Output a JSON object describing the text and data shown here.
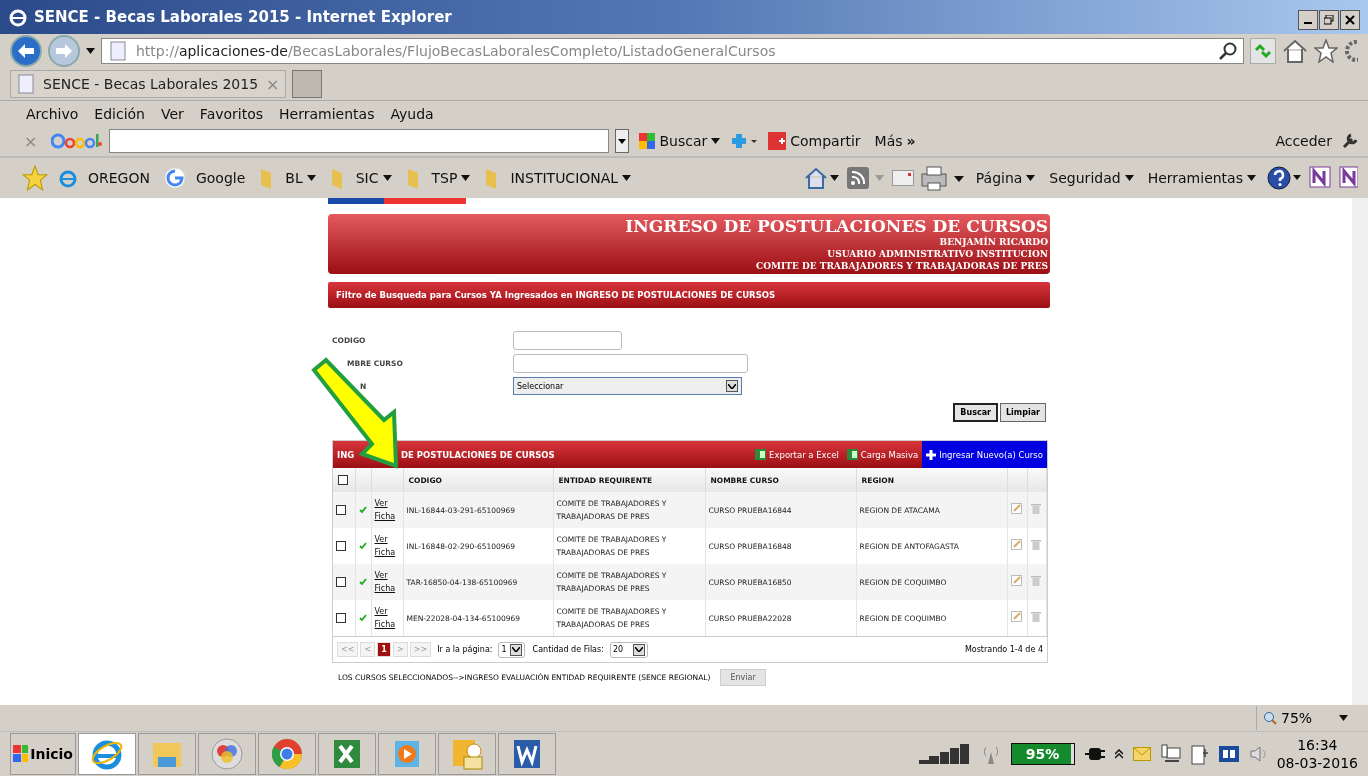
{
  "window": {
    "title": "SENCE - Becas Laborales 2015 - Internet Explorer"
  },
  "address": {
    "scheme": "http://",
    "host": "aplicaciones-de",
    "path": "/BecasLaborales/FlujoBecasLaboralesCompleto/ListadoGeneralCursos"
  },
  "tab": {
    "title": "SENCE - Becas Laborales 2015",
    "close": "×"
  },
  "menu": [
    "Archivo",
    "Edición",
    "Ver",
    "Favoritos",
    "Herramientas",
    "Ayuda"
  ],
  "google_toolbar": {
    "close": "×",
    "search_button": "Buscar",
    "share_button": "Compartir",
    "more": "Más",
    "more_glyph": "»",
    "sign_in": "Acceder"
  },
  "favorites": [
    {
      "kind": "ie",
      "label": "OREGON"
    },
    {
      "kind": "google",
      "label": "Google"
    },
    {
      "kind": "folder",
      "label": "BL"
    },
    {
      "kind": "folder",
      "label": "SIC"
    },
    {
      "kind": "folder",
      "label": "TSP"
    },
    {
      "kind": "folder",
      "label": "INSTITUCIONAL"
    }
  ],
  "command_bar": [
    "Página",
    "Seguridad",
    "Herramientas"
  ],
  "page_header": {
    "title": "INGRESO DE POSTULACIONES DE CURSOS",
    "lines": [
      "BENJAMÍN RICARDO",
      "USUARIO ADMINISTRATIVO INSTITUCION",
      "COMITE DE TRABAJADORES Y TRABAJADORAS DE PRES"
    ]
  },
  "filter": {
    "title": "Filtro de Busqueda para Cursos YA Ingresados en INGRESO DE POSTULACIONES DE CURSOS",
    "fields": [
      {
        "kind": "short",
        "label": "CODIGO"
      },
      {
        "kind": "long",
        "label": "MBRE CURSO"
      },
      {
        "kind": "select",
        "label": "N",
        "value": "Seleccionar"
      }
    ],
    "buttons": [
      "Buscar",
      "Limpiar"
    ]
  },
  "grid": {
    "title_start": "ING",
    "title_end": "DE POSTULACIONES DE CURSOS",
    "actions": [
      {
        "kind": "excel",
        "label": "Exportar a Excel"
      },
      {
        "kind": "excel",
        "label": "Carga Masiva"
      },
      {
        "kind": "new",
        "label": "Ingresar Nuevo(a) Curso"
      }
    ],
    "select_all_checked": false,
    "columns": [
      "CODIGO",
      "ENTIDAD REQUIRENTE",
      "NOMBRE CURSO",
      "REGION"
    ],
    "rows": [
      {
        "checked": false,
        "link": "Ver Ficha",
        "codigo": "INL-16844-03-291-65100969",
        "entidad": "COMITE DE TRABAJADORES Y TRABAJADORAS DE PRES",
        "nombre": "CURSO PRUEBA16844",
        "region": "REGION DE ATACAMA"
      },
      {
        "checked": false,
        "link": "Ver Ficha",
        "codigo": "INL-16848-02-290-65100969",
        "entidad": "COMITE DE TRABAJADORES Y TRABAJADORAS DE PRES",
        "nombre": "CURSO PRUEBA16848",
        "region": "REGION DE ANTOFAGASTA"
      },
      {
        "checked": false,
        "link": "Ver Ficha",
        "codigo": "TAR-16850-04-138-65100969",
        "entidad": "COMITE DE TRABAJADORES Y TRABAJADORAS DE PRES",
        "nombre": "CURSO PRUEBA16850",
        "region": "REGION DE COQUIMBO"
      },
      {
        "checked": false,
        "link": "Ver Ficha",
        "codigo": "MEN-22028-04-134-65100969",
        "entidad": "COMITE DE TRABAJADORES Y TRABAJADORAS DE PRES",
        "nombre": "CURSO PRUEBA22028",
        "region": "REGION DE COQUIMBO"
      }
    ],
    "pager": {
      "first": "<<",
      "prev": "<",
      "pages": [
        {
          "label": "1",
          "selected": true
        }
      ],
      "next": ">",
      "last": ">>",
      "goto_label": "Ir a la página:",
      "goto_value": "1",
      "rows_label": "Cantidad de Filas:",
      "rows_value": "20",
      "summary": "Mostrando 1-4 de 4"
    }
  },
  "footer": {
    "text": "LOS CURSOS SELECCIONADOS-->INGRESO EVALUACIÓN ENTIDAD REQUIRENTE (SENCE REGIONAL)",
    "button": "Enviar"
  },
  "status_bar": {
    "zoom": "75%"
  },
  "taskbar": {
    "start": "Inicio",
    "apps": [
      {
        "kind": "ie",
        "selected": true
      },
      {
        "kind": "explorer",
        "selected": false
      },
      {
        "kind": "media",
        "selected": false
      },
      {
        "kind": "chrome",
        "selected": false
      },
      {
        "kind": "excel",
        "selected": false
      },
      {
        "kind": "player",
        "selected": false
      },
      {
        "kind": "outlook",
        "selected": false
      },
      {
        "kind": "word",
        "selected": false
      }
    ],
    "battery": {
      "reading": "95%",
      "level": 0.95
    },
    "time": "16:34",
    "date": "08-03-2016"
  }
}
